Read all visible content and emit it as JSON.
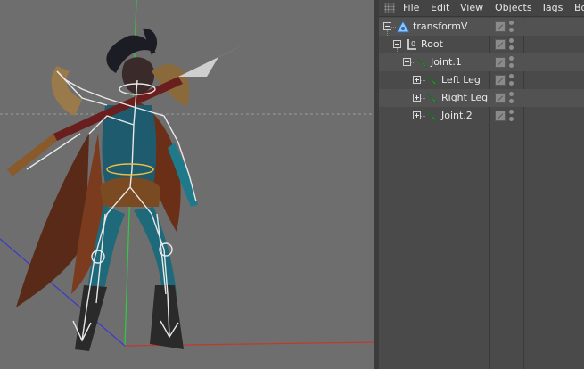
{
  "menubar": {
    "items": [
      "File",
      "Edit",
      "View",
      "Objects",
      "Tags",
      "Bo"
    ]
  },
  "object_tree": [
    {
      "label": "transformV",
      "icon": "null-object-icon",
      "depth": 0,
      "expander": "minus"
    },
    {
      "label": "Root",
      "icon": "root-joint-icon",
      "depth": 1,
      "expander": "minus"
    },
    {
      "label": "Joint.1",
      "icon": "joint-icon",
      "depth": 2,
      "expander": "minus"
    },
    {
      "label": "Left Leg",
      "icon": "joint-icon",
      "depth": 3,
      "expander": "plus"
    },
    {
      "label": "Right Leg",
      "icon": "joint-icon",
      "depth": 3,
      "expander": "plus"
    },
    {
      "label": "Joint.2",
      "icon": "joint-icon",
      "depth": 3,
      "expander": "plus"
    }
  ],
  "colors": {
    "viewport_bg": "#6e6e6e",
    "panel_bg": "#4a4a4a",
    "row_alt": "#525252",
    "joint_green": "#3ec24a",
    "axis_x": "#c0392b",
    "axis_y": "#2ecc40",
    "axis_z": "#3a3acc"
  }
}
